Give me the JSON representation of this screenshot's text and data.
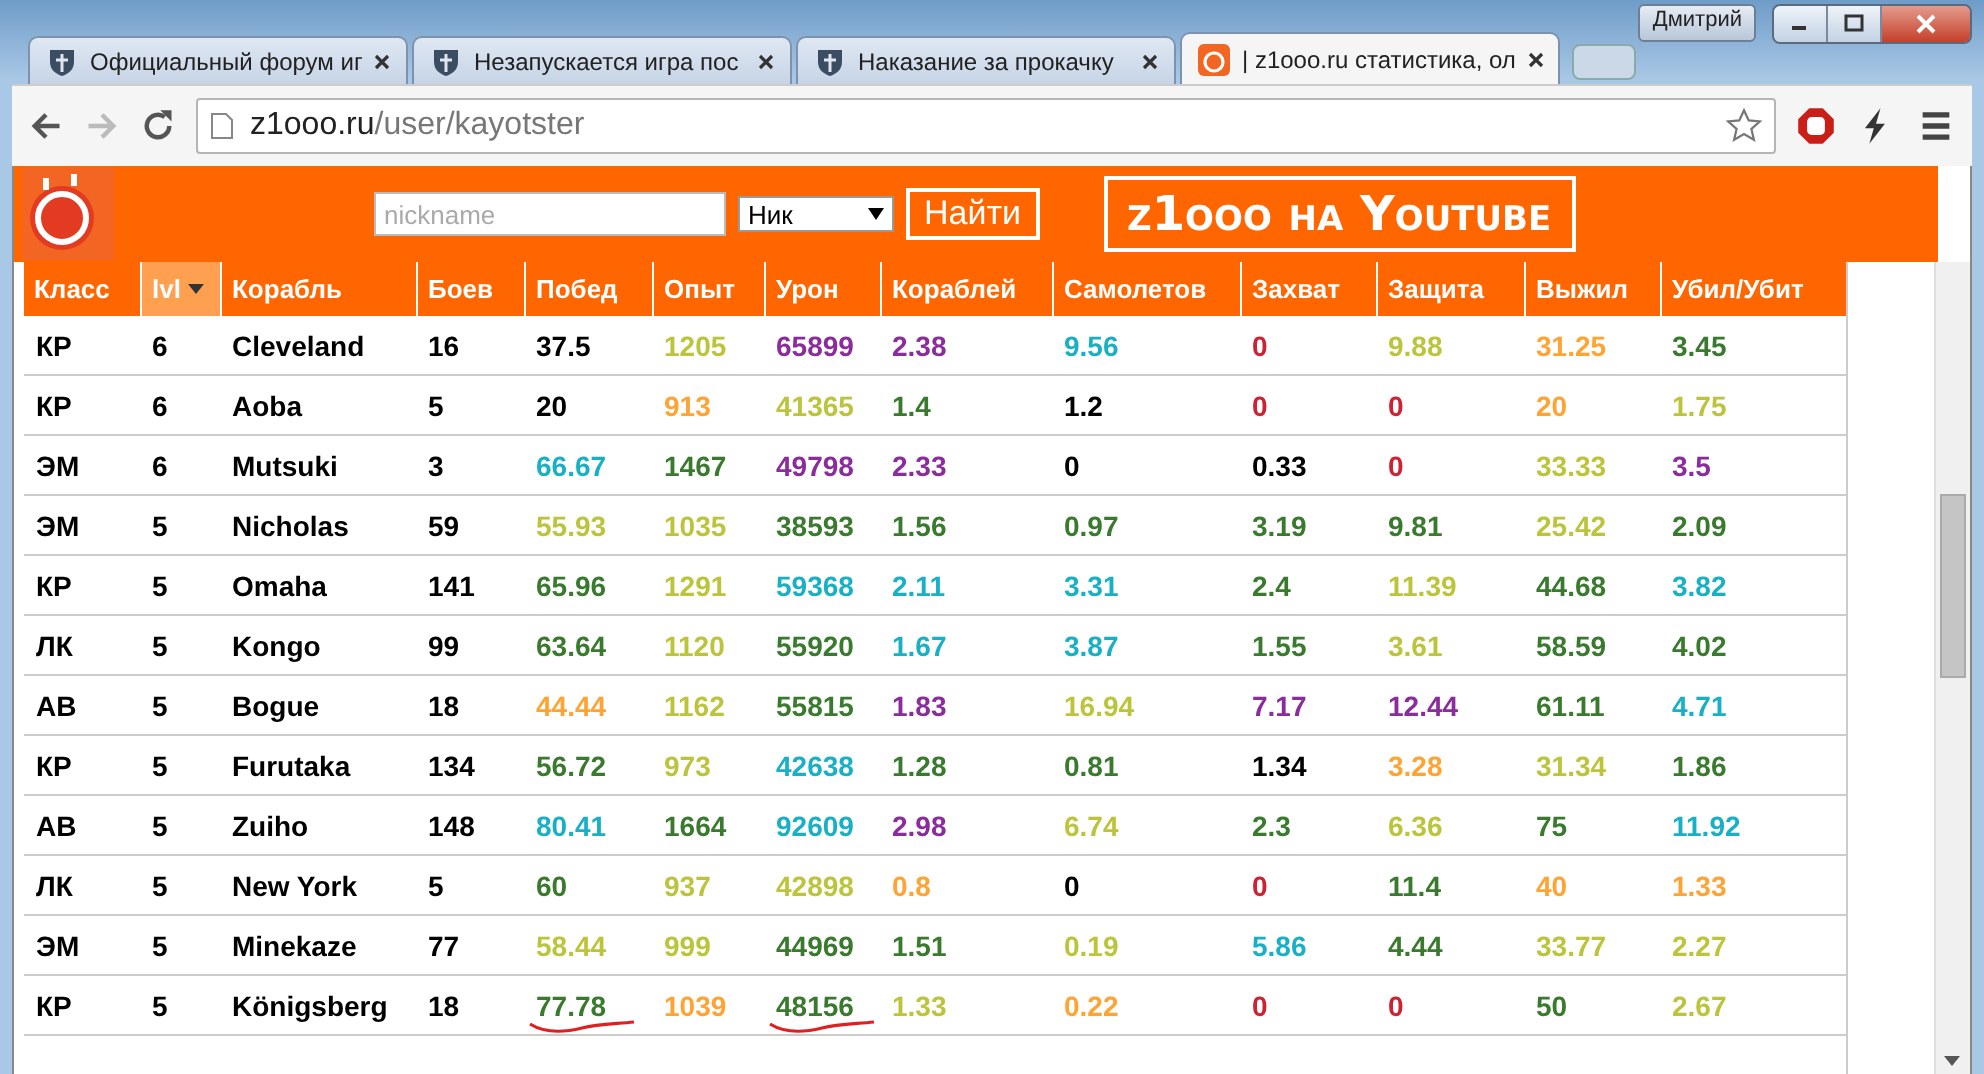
{
  "window": {
    "user": "Дмитрий"
  },
  "tabs": [
    {
      "label": "Официальный форум иг",
      "kind": "ship",
      "selected": false
    },
    {
      "label": "Незапускается игра пос",
      "kind": "ship",
      "selected": false
    },
    {
      "label": "Наказание за прокачку",
      "kind": "ship",
      "selected": false
    },
    {
      "label": "| z1ooo.ru статистика, ол",
      "kind": "site",
      "selected": true
    }
  ],
  "address_bar": {
    "host": "z1ooo.ru",
    "path": "/user/kayotster"
  },
  "header": {
    "search": {
      "placeholder": "nickname"
    },
    "select": {
      "value": "Ник"
    },
    "button": "Найти",
    "banner": "z1ooo на Youtube"
  },
  "table": {
    "columns": [
      {
        "label": "Класс",
        "sorted": false
      },
      {
        "label": "lvl",
        "sorted": true
      },
      {
        "label": "Корабль",
        "sorted": false
      },
      {
        "label": "Боев",
        "sorted": false
      },
      {
        "label": "Побед",
        "sorted": false
      },
      {
        "label": "Опыт",
        "sorted": false
      },
      {
        "label": "Урон",
        "sorted": false
      },
      {
        "label": "Кораблей",
        "sorted": false
      },
      {
        "label": "Самолетов",
        "sorted": false
      },
      {
        "label": "Захват",
        "sorted": false
      },
      {
        "label": "Защита",
        "sorted": false
      },
      {
        "label": "Выжил",
        "sorted": false
      },
      {
        "label": "Убил/Убит",
        "sorted": false
      }
    ],
    "rows": [
      {
        "class": "КР",
        "lvl": "6",
        "ship": "Cleveland",
        "battles": "16",
        "stats": [
          {
            "text": "37.5",
            "color": "#000000"
          },
          {
            "text": "1205",
            "color": "#bcc43c"
          },
          {
            "text": "65899",
            "color": "#8b2c9c"
          },
          {
            "text": "2.38",
            "color": "#8b2c9c"
          },
          {
            "text": "9.56",
            "color": "#19b0c6"
          },
          {
            "text": "0",
            "color": "#cc2233"
          },
          {
            "text": "9.88",
            "color": "#bcc43c"
          },
          {
            "text": "31.25",
            "color": "#ffa333"
          },
          {
            "text": "3.45",
            "color": "#3a7a2e"
          }
        ]
      },
      {
        "class": "КР",
        "lvl": "6",
        "ship": "Aoba",
        "battles": "5",
        "stats": [
          {
            "text": "20",
            "color": "#000000"
          },
          {
            "text": "913",
            "color": "#ffa333"
          },
          {
            "text": "41365",
            "color": "#bcc43c"
          },
          {
            "text": "1.4",
            "color": "#3a7a2e"
          },
          {
            "text": "1.2",
            "color": "#000000"
          },
          {
            "text": "0",
            "color": "#cc2233"
          },
          {
            "text": "0",
            "color": "#cc2233"
          },
          {
            "text": "20",
            "color": "#ffa333"
          },
          {
            "text": "1.75",
            "color": "#bcc43c"
          }
        ]
      },
      {
        "class": "ЭМ",
        "lvl": "6",
        "ship": "Mutsuki",
        "battles": "3",
        "stats": [
          {
            "text": "66.67",
            "color": "#19b0c6"
          },
          {
            "text": "1467",
            "color": "#3a7a2e"
          },
          {
            "text": "49798",
            "color": "#8b2c9c"
          },
          {
            "text": "2.33",
            "color": "#8b2c9c"
          },
          {
            "text": "0",
            "color": "#000000"
          },
          {
            "text": "0.33",
            "color": "#000000"
          },
          {
            "text": "0",
            "color": "#cc2233"
          },
          {
            "text": "33.33",
            "color": "#bcc43c"
          },
          {
            "text": "3.5",
            "color": "#8b2c9c"
          }
        ]
      },
      {
        "class": "ЭМ",
        "lvl": "5",
        "ship": "Nicholas",
        "battles": "59",
        "stats": [
          {
            "text": "55.93",
            "color": "#bcc43c"
          },
          {
            "text": "1035",
            "color": "#bcc43c"
          },
          {
            "text": "38593",
            "color": "#3a7a2e"
          },
          {
            "text": "1.56",
            "color": "#3a7a2e"
          },
          {
            "text": "0.97",
            "color": "#3a7a2e"
          },
          {
            "text": "3.19",
            "color": "#3a7a2e"
          },
          {
            "text": "9.81",
            "color": "#3a7a2e"
          },
          {
            "text": "25.42",
            "color": "#bcc43c"
          },
          {
            "text": "2.09",
            "color": "#3a7a2e"
          }
        ]
      },
      {
        "class": "КР",
        "lvl": "5",
        "ship": "Omaha",
        "battles": "141",
        "stats": [
          {
            "text": "65.96",
            "color": "#3a7a2e"
          },
          {
            "text": "1291",
            "color": "#bcc43c"
          },
          {
            "text": "59368",
            "color": "#19b0c6"
          },
          {
            "text": "2.11",
            "color": "#19b0c6"
          },
          {
            "text": "3.31",
            "color": "#19b0c6"
          },
          {
            "text": "2.4",
            "color": "#3a7a2e"
          },
          {
            "text": "11.39",
            "color": "#bcc43c"
          },
          {
            "text": "44.68",
            "color": "#3a7a2e"
          },
          {
            "text": "3.82",
            "color": "#19b0c6"
          }
        ]
      },
      {
        "class": "ЛК",
        "lvl": "5",
        "ship": "Kongo",
        "battles": "99",
        "stats": [
          {
            "text": "63.64",
            "color": "#3a7a2e"
          },
          {
            "text": "1120",
            "color": "#bcc43c"
          },
          {
            "text": "55920",
            "color": "#3a7a2e"
          },
          {
            "text": "1.67",
            "color": "#19b0c6"
          },
          {
            "text": "3.87",
            "color": "#19b0c6"
          },
          {
            "text": "1.55",
            "color": "#3a7a2e"
          },
          {
            "text": "3.61",
            "color": "#bcc43c"
          },
          {
            "text": "58.59",
            "color": "#3a7a2e"
          },
          {
            "text": "4.02",
            "color": "#3a7a2e"
          }
        ]
      },
      {
        "class": "АВ",
        "lvl": "5",
        "ship": "Bogue",
        "battles": "18",
        "stats": [
          {
            "text": "44.44",
            "color": "#ffa333"
          },
          {
            "text": "1162",
            "color": "#bcc43c"
          },
          {
            "text": "55815",
            "color": "#3a7a2e"
          },
          {
            "text": "1.83",
            "color": "#8b2c9c"
          },
          {
            "text": "16.94",
            "color": "#bcc43c"
          },
          {
            "text": "7.17",
            "color": "#8b2c9c"
          },
          {
            "text": "12.44",
            "color": "#8b2c9c"
          },
          {
            "text": "61.11",
            "color": "#3a7a2e"
          },
          {
            "text": "4.71",
            "color": "#19b0c6"
          }
        ]
      },
      {
        "class": "КР",
        "lvl": "5",
        "ship": "Furutaka",
        "battles": "134",
        "stats": [
          {
            "text": "56.72",
            "color": "#3a7a2e"
          },
          {
            "text": "973",
            "color": "#bcc43c"
          },
          {
            "text": "42638",
            "color": "#19b0c6"
          },
          {
            "text": "1.28",
            "color": "#3a7a2e"
          },
          {
            "text": "0.81",
            "color": "#3a7a2e"
          },
          {
            "text": "1.34",
            "color": "#000000"
          },
          {
            "text": "3.28",
            "color": "#ffa333"
          },
          {
            "text": "31.34",
            "color": "#bcc43c"
          },
          {
            "text": "1.86",
            "color": "#3a7a2e"
          }
        ]
      },
      {
        "class": "АВ",
        "lvl": "5",
        "ship": "Zuiho",
        "battles": "148",
        "stats": [
          {
            "text": "80.41",
            "color": "#19b0c6"
          },
          {
            "text": "1664",
            "color": "#3a7a2e"
          },
          {
            "text": "92609",
            "color": "#19b0c6"
          },
          {
            "text": "2.98",
            "color": "#8b2c9c"
          },
          {
            "text": "6.74",
            "color": "#bcc43c"
          },
          {
            "text": "2.3",
            "color": "#3a7a2e"
          },
          {
            "text": "6.36",
            "color": "#bcc43c"
          },
          {
            "text": "75",
            "color": "#3a7a2e"
          },
          {
            "text": "11.92",
            "color": "#19b0c6"
          }
        ]
      },
      {
        "class": "ЛК",
        "lvl": "5",
        "ship": "New York",
        "battles": "5",
        "stats": [
          {
            "text": "60",
            "color": "#3a7a2e"
          },
          {
            "text": "937",
            "color": "#bcc43c"
          },
          {
            "text": "42898",
            "color": "#bcc43c"
          },
          {
            "text": "0.8",
            "color": "#ffa333"
          },
          {
            "text": "0",
            "color": "#000000"
          },
          {
            "text": "0",
            "color": "#cc2233"
          },
          {
            "text": "11.4",
            "color": "#3a7a2e"
          },
          {
            "text": "40",
            "color": "#ffa333"
          },
          {
            "text": "1.33",
            "color": "#ffa333"
          }
        ]
      },
      {
        "class": "ЭМ",
        "lvl": "5",
        "ship": "Minekaze",
        "battles": "77",
        "stats": [
          {
            "text": "58.44",
            "color": "#bcc43c"
          },
          {
            "text": "999",
            "color": "#bcc43c"
          },
          {
            "text": "44969",
            "color": "#3a7a2e"
          },
          {
            "text": "1.51",
            "color": "#3a7a2e"
          },
          {
            "text": "0.19",
            "color": "#bcc43c"
          },
          {
            "text": "5.86",
            "color": "#19b0c6"
          },
          {
            "text": "4.44",
            "color": "#3a7a2e"
          },
          {
            "text": "33.77",
            "color": "#bcc43c"
          },
          {
            "text": "2.27",
            "color": "#bcc43c"
          }
        ]
      },
      {
        "class": "КР",
        "lvl": "5",
        "ship": "Königsberg",
        "battles": "18",
        "stats": [
          {
            "text": "77.78",
            "color": "#3a7a2e",
            "underlined": true
          },
          {
            "text": "1039",
            "color": "#ffa333"
          },
          {
            "text": "48156",
            "color": "#3a7a2e",
            "underlined": true
          },
          {
            "text": "1.33",
            "color": "#bcc43c"
          },
          {
            "text": "0.22",
            "color": "#ffa333"
          },
          {
            "text": "0",
            "color": "#cc2233"
          },
          {
            "text": "0",
            "color": "#cc2233"
          },
          {
            "text": "50",
            "color": "#3a7a2e"
          },
          {
            "text": "2.67",
            "color": "#bcc43c"
          }
        ]
      }
    ]
  }
}
